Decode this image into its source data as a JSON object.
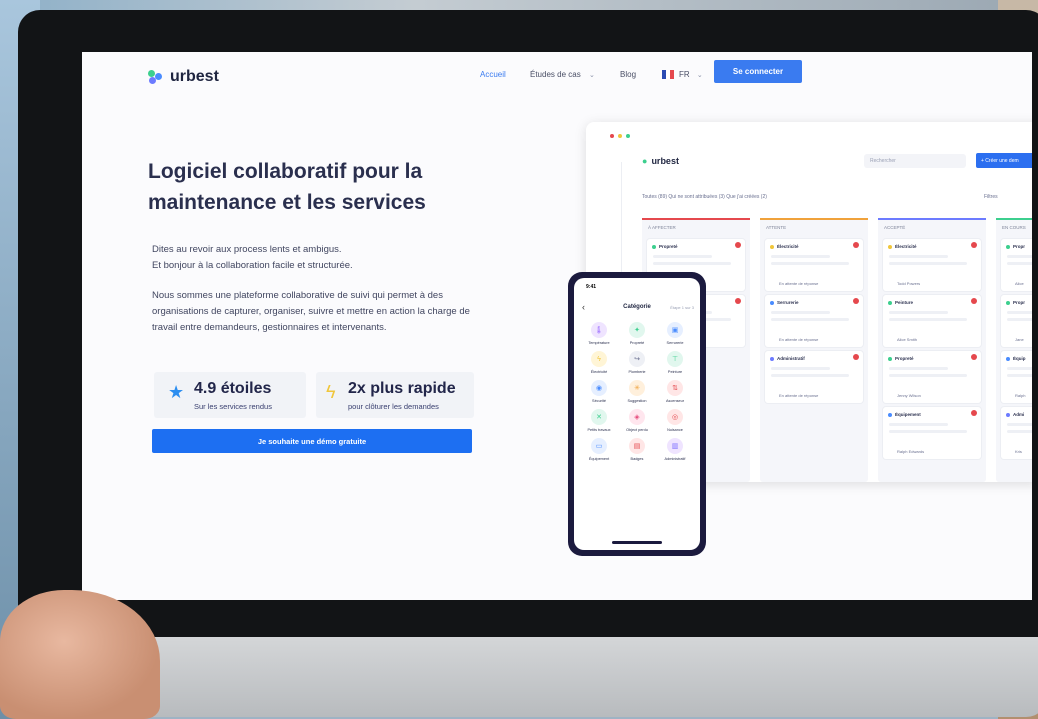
{
  "nav": {
    "brand": "urbest",
    "links": [
      {
        "label": "Accueil",
        "active": true
      },
      {
        "label": "Études de cas",
        "dropdown": true
      },
      {
        "label": "Blog"
      }
    ],
    "language": "FR",
    "connect_label": "Se connecter"
  },
  "hero": {
    "title": "Logiciel collaboratif pour la maintenance et les services",
    "intro_line1": "Dites au revoir aux process lents et ambigus.",
    "intro_line2": "Et bonjour à la collaboration facile et structurée.",
    "body": "Nous sommes une plateforme collaborative de suivi qui permet à des organisations de capturer, organiser, suivre et mettre en action la charge de travail entre demandeurs, gestionnaires et intervenants.",
    "stat1": {
      "value": "4.9 étoiles",
      "sub": "Sur les services rendus",
      "icon": "star-icon"
    },
    "stat2": {
      "value": "2x plus rapide",
      "sub": "pour clôturer les demandes",
      "icon": "lightning-icon"
    },
    "demo_label": "Je souhaite une démo gratuite"
  },
  "dashboard": {
    "brand": "urbest",
    "search_placeholder": "Rechercher",
    "create_label": "+ Créer une dem",
    "tabs": "Toutes (89)   Qui ne sont attribuées (3)   Que j'ai créées (2)",
    "filters_label": "Filtres",
    "columns": [
      {
        "title": "À AFFECTER",
        "color": "#e5484d",
        "cards": [
          {
            "title": "Propreté",
            "foot": "Affecter un responsable",
            "dot": "#3ccf8e"
          },
          {
            "title": "Plomberie",
            "foot": "",
            "dot": "#6c7bff"
          }
        ]
      },
      {
        "title": "ATTENTE",
        "color": "#f0a23b",
        "cards": [
          {
            "title": "Électricité",
            "foot": "En attente de réponse",
            "dot": "#f0c63b"
          },
          {
            "title": "Serrurerie",
            "foot": "En attente de réponse",
            "dot": "#4a8cff"
          },
          {
            "title": "Administratif",
            "foot": "En attente de réponse",
            "dot": "#6c7bff"
          }
        ]
      },
      {
        "title": "ACCEPTÉ",
        "color": "#6c7bff",
        "cards": [
          {
            "title": "Électricité",
            "foot": "Todd Powers",
            "dot": "#f0c63b"
          },
          {
            "title": "Peinture",
            "foot": "Alice Smith",
            "dot": "#3ccf8e"
          },
          {
            "title": "Propreté",
            "foot": "Jenny Wilson",
            "dot": "#3ccf8e"
          },
          {
            "title": "Équipement",
            "foot": "Ralph Edwards",
            "dot": "#4a8cff"
          }
        ]
      },
      {
        "title": "EN COURS",
        "color": "#3ccf8e",
        "cards": [
          {
            "title": "Propr",
            "foot": "Alice",
            "dot": "#3ccf8e"
          },
          {
            "title": "Propr",
            "foot": "Jane",
            "dot": "#3ccf8e"
          },
          {
            "title": "Équip",
            "foot": "Ralph",
            "dot": "#4a8cff"
          },
          {
            "title": "Admi",
            "foot": "Kris",
            "dot": "#6c7bff"
          }
        ]
      }
    ]
  },
  "phone": {
    "time": "9:41",
    "title": "Catégorie",
    "step": "Étape 1 sur 3",
    "categories": [
      {
        "label": "Température",
        "bg": "#efe4ff",
        "fg": "#9b6bff",
        "glyph": "🌡"
      },
      {
        "label": "Propreté",
        "bg": "#e1f7ee",
        "fg": "#3ccf8e",
        "glyph": "✦"
      },
      {
        "label": "Serrurerie",
        "bg": "#e6efff",
        "fg": "#4a8cff",
        "glyph": "▣"
      },
      {
        "label": "Électricité",
        "bg": "#fff5d6",
        "fg": "#f0c63b",
        "glyph": "ϟ"
      },
      {
        "label": "Plomberie",
        "bg": "#eef0f5",
        "fg": "#6a7090",
        "glyph": "↪"
      },
      {
        "label": "Peinture",
        "bg": "#e1f7ee",
        "fg": "#3ccf8e",
        "glyph": "⊤"
      },
      {
        "label": "Sécurité",
        "bg": "#e6efff",
        "fg": "#4a8cff",
        "glyph": "◉"
      },
      {
        "label": "Suggestion",
        "bg": "#fff0dc",
        "fg": "#f0a23b",
        "glyph": "✳"
      },
      {
        "label": "Ascenseur",
        "bg": "#ffe6e6",
        "fg": "#e5484d",
        "glyph": "⇅"
      },
      {
        "label": "Petits travaux",
        "bg": "#e1f7ee",
        "fg": "#3ccf8e",
        "glyph": "✕"
      },
      {
        "label": "Object perdu",
        "bg": "#ffe6ee",
        "fg": "#e5487a",
        "glyph": "◈"
      },
      {
        "label": "Nuisance",
        "bg": "#ffe6e6",
        "fg": "#e5484d",
        "glyph": "◎"
      },
      {
        "label": "Équipement",
        "bg": "#e6efff",
        "fg": "#4a8cff",
        "glyph": "▭"
      },
      {
        "label": "Badges",
        "bg": "#ffe6e6",
        "fg": "#e5484d",
        "glyph": "▤"
      },
      {
        "label": "Administratif",
        "bg": "#efe4ff",
        "fg": "#7a6bff",
        "glyph": "▥"
      }
    ]
  }
}
